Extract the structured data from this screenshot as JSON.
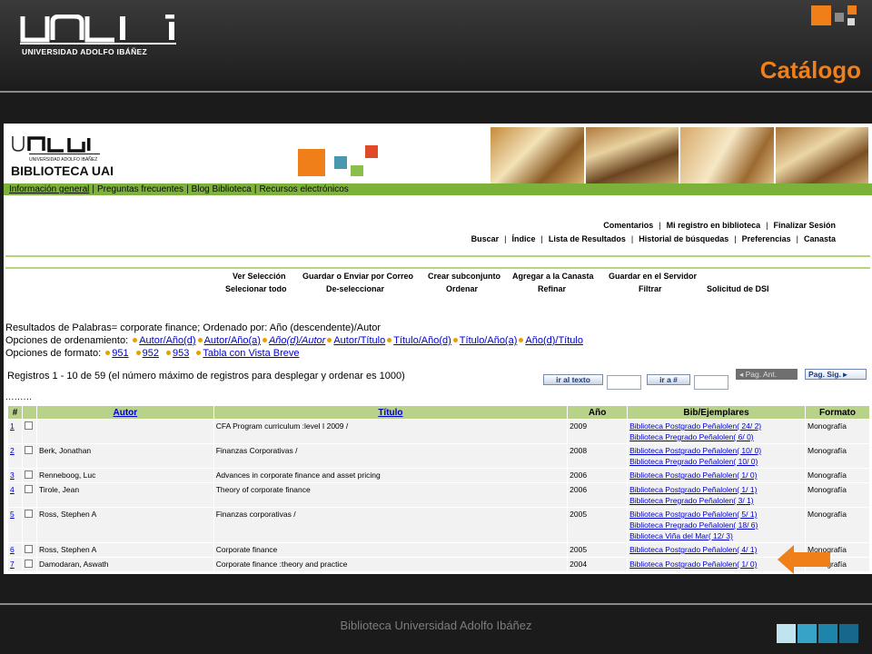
{
  "slide": {
    "logo_text": "UNIVERSIDAD ADOLFO IBÁÑEZ",
    "title": "Catálogo",
    "footer": "Biblioteca Universidad Adolfo Ibáñez",
    "colors": {
      "accent": "#f07f1a",
      "teal": "#4a98b0",
      "green": "#7cb13a"
    }
  },
  "banner": {
    "logo_small_text": "UNIVERSIDAD ADOLFO IBÁÑEZ",
    "name": "BIBLIOTECA UAI"
  },
  "top_nav": [
    "Información general",
    "Preguntas frecuentes",
    "Blog Biblioteca",
    "Recursos electrónicos"
  ],
  "menu_row_1": [
    "Comentarios",
    "Mi registro en biblioteca",
    "Finalizar Sesión"
  ],
  "menu_row_2": [
    "Buscar",
    "Índice",
    "Lista de Resultados",
    "Historial de búsquedas",
    "Preferencias",
    "Canasta"
  ],
  "actions_1": [
    "Ver Selección",
    "Guardar o Enviar por Correo",
    "Crear subconjunto",
    "Agregar a la Canasta",
    "Guardar en el Servidor"
  ],
  "actions_2": [
    "Selecionar todo",
    "De-seleccionar",
    "Ordenar",
    "Refinar",
    "Filtrar",
    "Solicitud de DSI"
  ],
  "results": {
    "search_line": "Resultados de Palabras= corporate finance; Ordenado por: Año (descendente)/Autor",
    "sort_label": "Opciones de ordenamiento:",
    "sort_options": [
      "Autor/Año(d)",
      "Autor/Año(a)",
      "Año(d)/Autor",
      "Autor/Título",
      "Título/Año(d)",
      "Título/Año(a)",
      "Año(d)/Título"
    ],
    "format_label": "Opciones de formato:",
    "format_options": [
      "951",
      "952",
      "953",
      "Tabla con Vista Breve"
    ],
    "records_line": "Registros 1 - 10 de 59 (el número máximo de registros para desplegar y ordenar es 1000)",
    "goto_text_button": "ir al texto",
    "goto_num_button": "ir a #",
    "prev_button": "Pag. Ant.",
    "next_button": "Pag. Sig."
  },
  "table": {
    "headers": [
      "#",
      "Autor",
      "Título",
      "Año",
      "Bib/Ejemplares",
      "Formato"
    ],
    "rows": [
      {
        "num": "1",
        "author": "",
        "title": "CFA Program curriculum :level I 2009 /",
        "year": "2009",
        "holdings": [
          "Biblioteca Postgrado Peñalolen( 24/ 2)",
          "Biblioteca Pregrado Peñalolen( 6/ 0)"
        ],
        "format": "Monografía"
      },
      {
        "num": "2",
        "author": "Berk, Jonathan",
        "title": "Finanzas Corporativas /",
        "year": "2008",
        "holdings": [
          "Biblioteca Postgrado Peñalolen( 10/ 0)",
          "Biblioteca Pregrado Peñalolen( 10/ 0)"
        ],
        "format": "Monografía"
      },
      {
        "num": "3",
        "author": "Renneboog, Luc",
        "title": "Advances in corporate finance and asset pricing",
        "year": "2006",
        "holdings": [
          "Biblioteca Postgrado Peñalolen( 1/ 0)"
        ],
        "format": "Monografía"
      },
      {
        "num": "4",
        "author": "Tirole, Jean",
        "title": "Theory of corporate finance",
        "year": "2006",
        "holdings": [
          "Biblioteca Postgrado Peñalolen( 1/ 1)",
          "Biblioteca Pregrado Peñalolen( 3/ 1)"
        ],
        "format": "Monografía"
      },
      {
        "num": "5",
        "author": "Ross, Stephen A",
        "title": "Finanzas corporativas /",
        "year": "2005",
        "holdings": [
          "Biblioteca Postgrado Peñalolen( 5/ 1)",
          "Biblioteca Pregrado Peñalolen( 18/ 6)",
          "Biblioteca Viña del Mar( 12/ 3)"
        ],
        "format": "Monografía"
      },
      {
        "num": "6",
        "author": "Ross, Stephen A",
        "title": "Corporate finance",
        "year": "2005",
        "holdings": [
          "Biblioteca Postgrado Peñalolen( 4/ 1)"
        ],
        "format": "Monografía"
      },
      {
        "num": "7",
        "author": "Damodaran, Aswath",
        "title": "Corporate finance :theory and practice",
        "year": "2004",
        "holdings": [
          "Biblioteca Postgrado Peñalolen( 1/ 0)"
        ],
        "format": "Monografía"
      }
    ]
  },
  "icons": [
    "checkbox-icon",
    "orange-arrow-icon",
    "uai-logo-icon"
  ]
}
